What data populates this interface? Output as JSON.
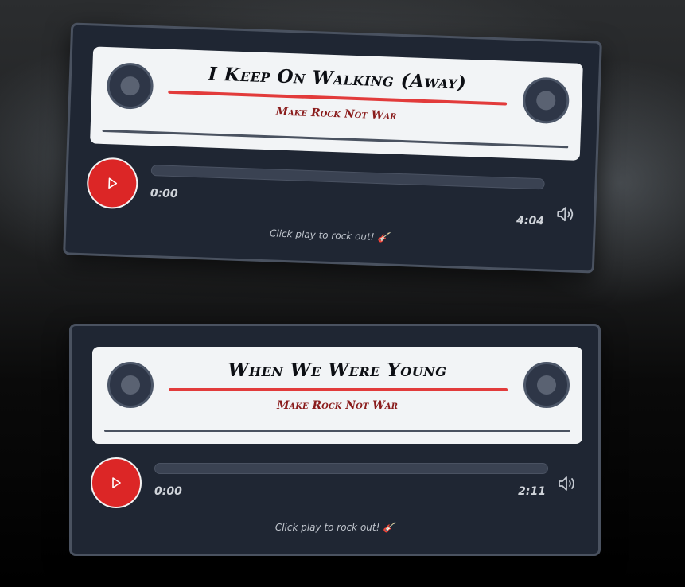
{
  "players": [
    {
      "title": "I Keep On Walking (Away)",
      "band": "Make Rock Not War",
      "current_time": "0:00",
      "duration": "4:04",
      "hint": "Click play to rock out! 🎸",
      "progress": 0
    },
    {
      "title": "When We Were Young",
      "band": "Make Rock Not War",
      "current_time": "0:00",
      "duration": "2:11",
      "hint": "Click play to rock out! 🎸",
      "progress": 0
    }
  ],
  "colors": {
    "accent": "#dc2626",
    "panel": "#1f2633",
    "cassette": "#f2f4f6",
    "band_text": "#8a1c1c"
  },
  "icons": {
    "play": "play-icon",
    "volume": "volume-icon",
    "reel": "reel-icon"
  }
}
